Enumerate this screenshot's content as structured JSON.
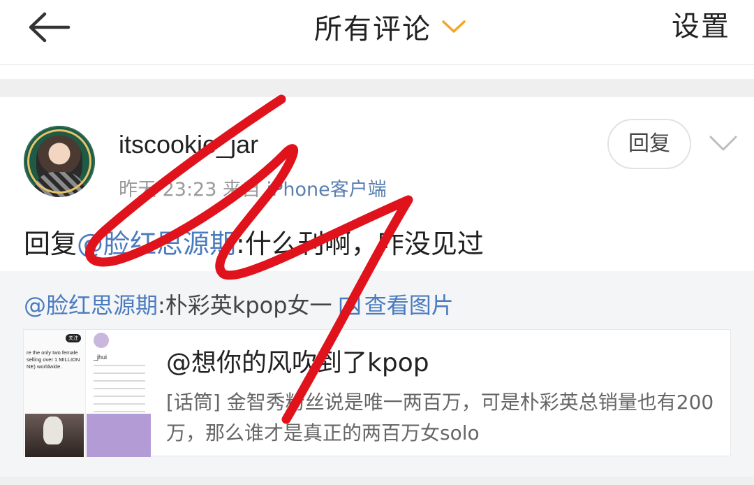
{
  "header": {
    "title": "所有评论",
    "settings_label": "设置",
    "accent_color": "#f5a623"
  },
  "comment": {
    "username": "itscookie_jar",
    "time": "昨天 23:23",
    "source_prefix": "来自",
    "client": "iPhone客户端",
    "reply_label": "回复",
    "text_prefix": "回复",
    "mention": "@脸红思源期",
    "text_suffix": ":什么刊啊，咋没见过"
  },
  "quote": {
    "mention": "@脸红思源期",
    "text": ":朴彩英kpop女一",
    "view_image_label": "查看图片"
  },
  "post": {
    "title": "@想你的风吹到了kpop",
    "body": "[话筒] 金智秀粉丝说是唯一两百万，可是朴彩英总销量也有200万，那么谁才是真正的两百万女solo",
    "thumb_badge": "关注",
    "thumb_caption": "re the only two female selling over 1 MILLION NE) worldwide.",
    "thumb_name": "_jhui"
  },
  "icons": {
    "back": "back-arrow-icon",
    "dropdown": "chevron-down-icon",
    "more": "chevron-down-icon",
    "image": "image-icon"
  },
  "colors": {
    "link": "#4b7bbf",
    "scribble": "#e0121b"
  }
}
